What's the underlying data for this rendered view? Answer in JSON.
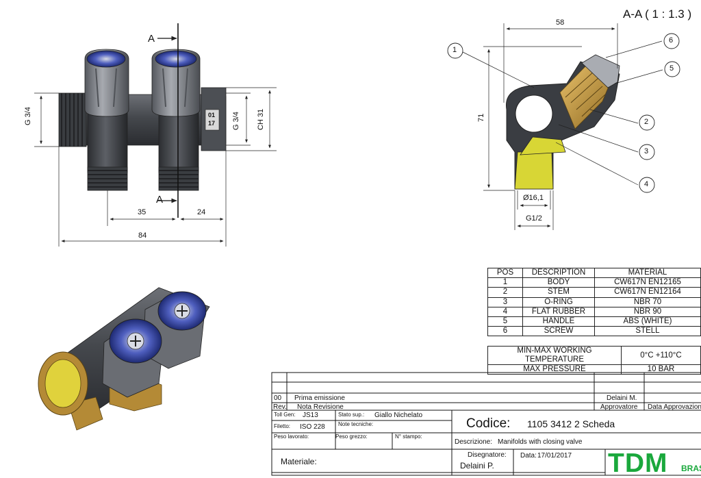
{
  "section_title": "A-A ( 1 : 1.3 )",
  "front_view": {
    "section_marker": "A",
    "dim_thread_left": "G 3/4",
    "dim_thread_right": "G 3/4",
    "dim_hex": "CH 31",
    "dim_pitch": "35",
    "dim_end": "24",
    "dim_length": "84",
    "body_mark_line1": "01",
    "body_mark_line2": "17"
  },
  "section_view": {
    "dim_width": "58",
    "dim_height": "71",
    "dim_bore": "Ø16,1",
    "dim_thread": "G1/2",
    "balloons": [
      "1",
      "2",
      "3",
      "4",
      "5",
      "6"
    ]
  },
  "bom": {
    "headers": [
      "POS",
      "DESCRIPTION",
      "MATERIAL"
    ],
    "rows": [
      [
        "1",
        "BODY",
        "CW617N EN12165"
      ],
      [
        "2",
        "STEM",
        "CW617N EN12164"
      ],
      [
        "3",
        "O-RING",
        "NBR 70"
      ],
      [
        "4",
        "FLAT RUBBER",
        "NBR 90"
      ],
      [
        "5",
        "HANDLE",
        "ABS (WHITE)"
      ],
      [
        "6",
        "SCREW",
        "STELL"
      ]
    ]
  },
  "specs": [
    [
      "MIN-MAX  WORKING TEMPERATURE",
      "0°C +110°C"
    ],
    [
      "MAX PRESSURE",
      "10 BAR"
    ]
  ],
  "title_block": {
    "rev_number": "00",
    "rev_description": "Prima emissione",
    "rev_approver": "Delaini M.",
    "rev_label": "Rev.",
    "rev_header": "Nota Revisione",
    "approver_header": "Approvatore",
    "approval_date_header": "Data Approvazione",
    "tolerance_label": "Toll Gen:",
    "tolerance_value": "JS13",
    "surface_label": "Stato sup.:",
    "surface_value": "Giallo Nichelato",
    "thread_label": "Filetto:",
    "thread_value": "ISO 228",
    "notes_label": "Note tecniche:",
    "worked_weight_label": "Peso lavorato:",
    "raw_weight_label": "Peso grezzo:",
    "mold_label": "N° stampo:",
    "code_label": "Codice:",
    "code_value": "1105 3412 2 Scheda",
    "description_label": "Descrizione:",
    "description_value": "Manifolds with closing valve",
    "material_label": "Materiale:",
    "designer_label": "Disegnatore:",
    "designer_value": "Delaini P.",
    "date_label": "Data:",
    "date_value": "17/01/2017",
    "logo_text": "TDM",
    "logo_sub": "BRASS"
  },
  "colors": {
    "body_dark": "#3c3f44",
    "handle_grey": "#7d8086",
    "knob_blue": "#2f3f9a",
    "brass": "#c79a3e",
    "yellow_port": "#d8d635",
    "logo_green": "#1aa83c"
  }
}
